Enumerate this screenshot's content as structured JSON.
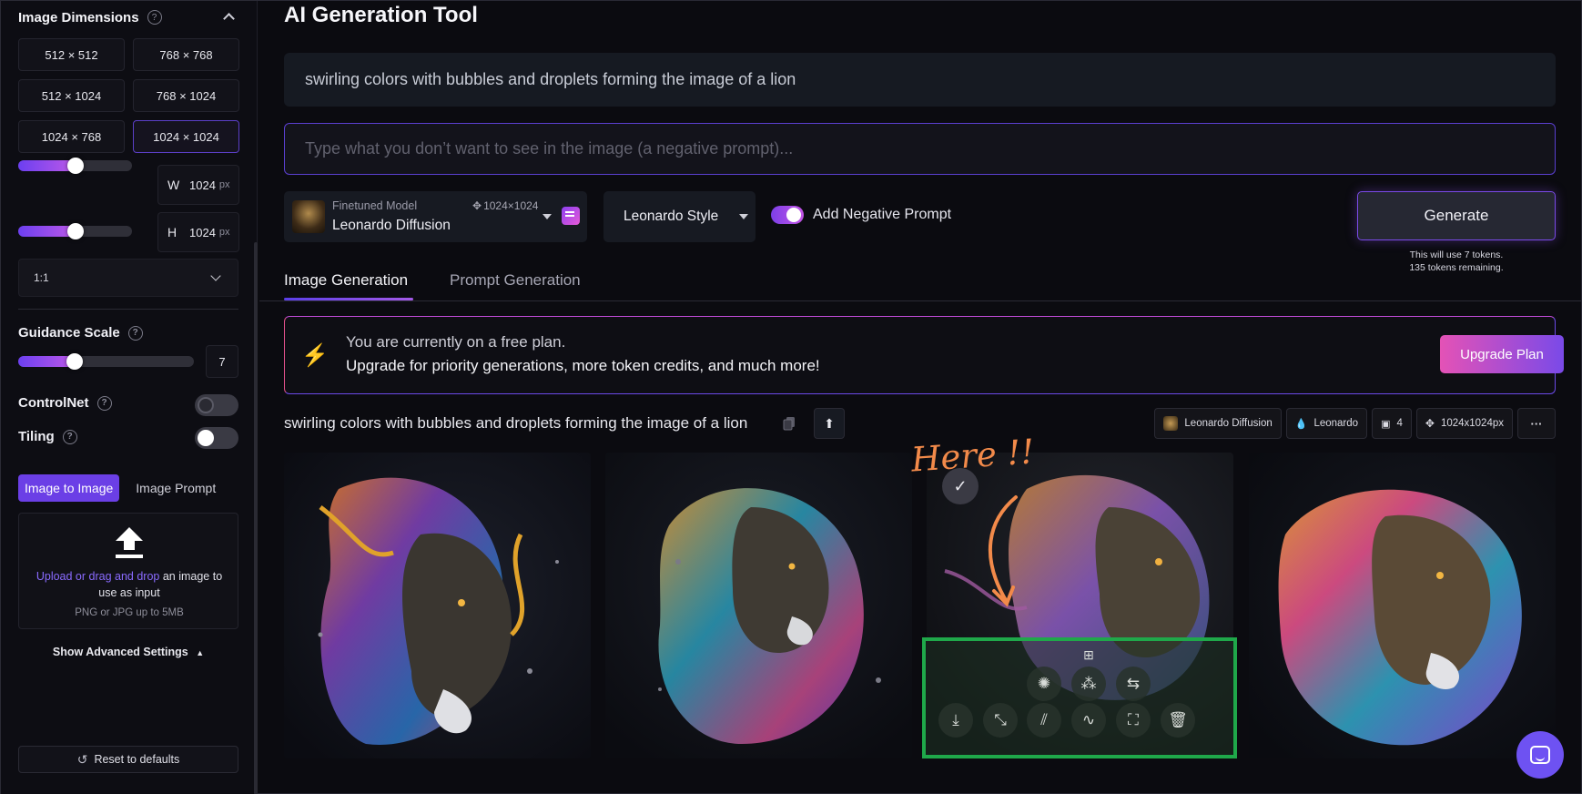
{
  "sidebar": {
    "image_dimensions": {
      "title": "Image Dimensions",
      "help": "?",
      "presets": [
        "512 × 512",
        "768 × 768",
        "512 × 1024",
        "768 × 1024",
        "1024 × 768",
        "1024 × 1024"
      ],
      "active_preset": "1024 × 1024",
      "width_label": "W",
      "width_value": "1024",
      "width_unit": "px",
      "height_label": "H",
      "height_value": "1024",
      "height_unit": "px",
      "width_slider_fraction": 0.5,
      "height_slider_fraction": 0.5,
      "aspect_ratio": "1:1"
    },
    "guidance_scale": {
      "label": "Guidance Scale",
      "help": "?",
      "value": "7",
      "slider_fraction": 0.3
    },
    "controlnet": {
      "label": "ControlNet",
      "help": "?",
      "enabled": false
    },
    "tiling": {
      "label": "Tiling",
      "help": "?",
      "enabled": false
    },
    "input_tabs": {
      "active": "Image to Image",
      "inactive": "Image Prompt"
    },
    "upload": {
      "link": "Upload or drag and drop",
      "text": " an image to use as input",
      "sub": "PNG or JPG up to 5MB"
    },
    "advanced": "Show Advanced Settings",
    "reset": "Reset to defaults"
  },
  "main": {
    "title": "AI Generation Tool",
    "prompt": "swirling colors with bubbles and droplets forming the image of a lion",
    "negative_placeholder": "Type what you don’t want to see in the image (a negative prompt)...",
    "model": {
      "kind": "Finetuned Model",
      "name": "Leonardo Diffusion",
      "size": "1024×1024"
    },
    "style": "Leonardo Style",
    "negative_toggle": {
      "label": "Add Negative Prompt",
      "enabled": true
    },
    "generate": {
      "label": "Generate",
      "note_line1": "This will use 7 tokens.",
      "note_line2": "135 tokens remaining."
    },
    "tabs": [
      "Image Generation",
      "Prompt Generation"
    ],
    "banner": {
      "line1": "You are currently on a free plan.",
      "line2": "Upgrade for priority generations, more token credits, and much more!",
      "button": "Upgrade Plan"
    },
    "generation": {
      "prompt": "swirling colors with bubbles and droplets forming the image of a lion",
      "chips": {
        "model": "Leonardo Diffusion",
        "style": "Leonardo",
        "count": "4",
        "size": "1024x1024px",
        "more": "···"
      }
    },
    "annotation": "Here !!"
  },
  "colors": {
    "accent": "#6b3fe6",
    "highlight_box": "#1fa84a",
    "annotation": "#f28a4a"
  }
}
